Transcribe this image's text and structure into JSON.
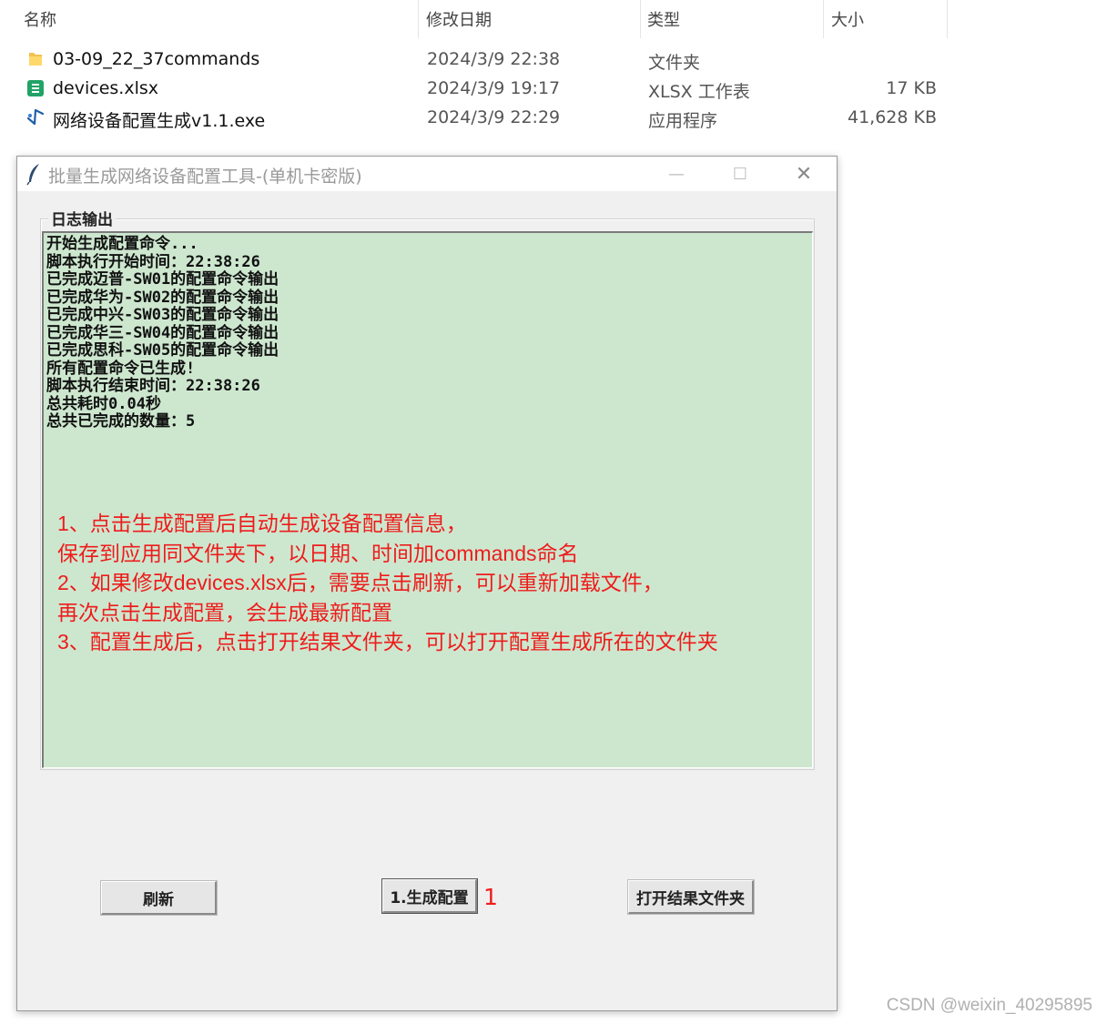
{
  "explorer": {
    "columns": [
      {
        "label": "名称"
      },
      {
        "label": "修改日期"
      },
      {
        "label": "类型"
      },
      {
        "label": "大小"
      }
    ],
    "files": [
      {
        "icon": "folder-icon",
        "name": "03-09_22_37commands",
        "date": "2024/3/9 22:38",
        "type": "文件夹",
        "size": ""
      },
      {
        "icon": "spreadsheet-icon",
        "name": "devices.xlsx",
        "date": "2024/3/9 19:17",
        "type": "XLSX 工作表",
        "size": "17 KB"
      },
      {
        "icon": "application-icon",
        "name": "网络设备配置生成v1.1.exe",
        "date": "2024/3/9 22:29",
        "type": "应用程序",
        "size": "41,628 KB"
      }
    ]
  },
  "window": {
    "icon": "feather-icon",
    "title": "批量生成网络设备配置工具-(单机卡密版)",
    "minimize_glyph": "—",
    "maximize_glyph": "☐",
    "close_glyph": "✕"
  },
  "log": {
    "legend": "日志输出",
    "lines": [
      "开始生成配置命令...",
      "脚本执行开始时间：22:38:26",
      "已完成迈普-SW01的配置命令输出",
      "已完成华为-SW02的配置命令输出",
      "已完成中兴-SW03的配置命令输出",
      "已完成华三-SW04的配置命令输出",
      "已完成思科-SW05的配置命令输出",
      "所有配置命令已生成!",
      "脚本执行结束时间：22:38:26",
      "总共耗时0.04秒",
      "总共已完成的数量：5"
    ]
  },
  "notes": [
    "1、点击生成配置后自动生成设备配置信息，",
    "保存到应用同文件夹下，以日期、时间加commands命名",
    "2、如果修改devices.xlsx后，需要点击刷新，可以重新加载文件，",
    "再次点击生成配置，会生成最新配置",
    "3、配置生成后，点击打开结果文件夹，可以打开配置生成所在的文件夹"
  ],
  "buttons": {
    "refresh": "刷新",
    "generate": "1.生成配置",
    "open_folder": "打开结果文件夹"
  },
  "annotation": "1",
  "watermark": "CSDN @weixin_40295895",
  "colors": {
    "log_background": "#cde7cf",
    "annotation_red": "#ee1c1c",
    "window_background": "#f0f0f0"
  }
}
